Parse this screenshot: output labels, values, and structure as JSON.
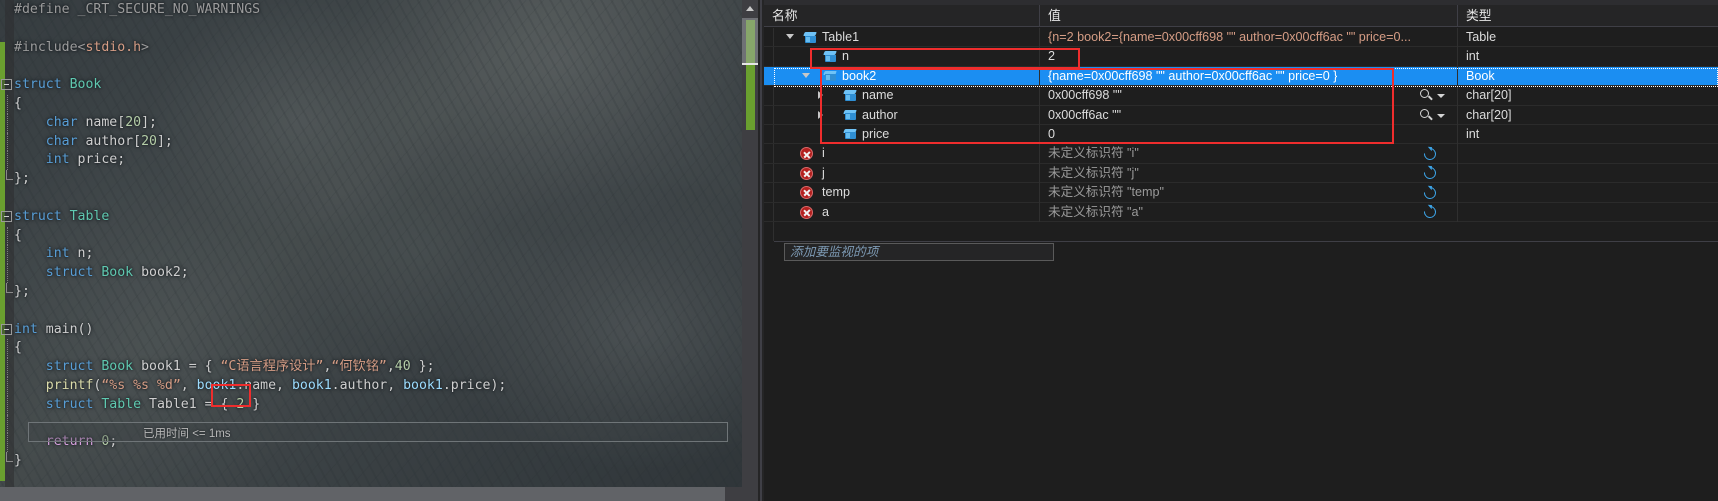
{
  "editor": {
    "code_lines": [
      {
        "indent": 0,
        "fold": false,
        "html": "<span class=\"pre\">#define _CRT_SECURE_NO_WARNINGS</span>"
      },
      {
        "indent": 0,
        "fold": false,
        "html": ""
      },
      {
        "indent": 0,
        "fold": false,
        "html": "<span class=\"pre\">#include&lt;</span><span class=\"hdr\">stdio.h</span><span class=\"pre\">&gt;</span>"
      },
      {
        "indent": 0,
        "fold": false,
        "html": ""
      },
      {
        "indent": 0,
        "fold": true,
        "html": "<span class=\"kw\">struct</span> <span class=\"typ\">Book</span>"
      },
      {
        "indent": 0,
        "fold": false,
        "html": "<span class=\"pun\">{</span>"
      },
      {
        "indent": 0,
        "fold": false,
        "html": "    <span class=\"kw\">char</span> <span class=\"pun\">name[</span><span class=\"num\">20</span><span class=\"pun\">];</span>"
      },
      {
        "indent": 0,
        "fold": false,
        "html": "    <span class=\"kw\">char</span> <span class=\"pun\">author[</span><span class=\"num\">20</span><span class=\"pun\">];</span>"
      },
      {
        "indent": 0,
        "fold": false,
        "html": "    <span class=\"kw\">int</span> <span class=\"pun\">price;</span>"
      },
      {
        "indent": 0,
        "fold": false,
        "html": "<span class=\"pun\">};</span>"
      },
      {
        "indent": 0,
        "fold": false,
        "html": ""
      },
      {
        "indent": 0,
        "fold": true,
        "html": "<span class=\"kw\">struct</span> <span class=\"typ\">Table</span>"
      },
      {
        "indent": 0,
        "fold": false,
        "html": "<span class=\"pun\">{</span>"
      },
      {
        "indent": 0,
        "fold": false,
        "html": "    <span class=\"kw\">int</span> <span class=\"pun\">n;</span>"
      },
      {
        "indent": 0,
        "fold": false,
        "html": "    <span class=\"kw\">struct</span> <span class=\"typ\">Book</span> <span class=\"pun\">book2;</span>"
      },
      {
        "indent": 0,
        "fold": false,
        "html": "<span class=\"pun\">};</span>"
      },
      {
        "indent": 0,
        "fold": false,
        "html": ""
      },
      {
        "indent": 0,
        "fold": true,
        "html": "<span class=\"kw\">int</span> <span class=\"pun\">main()</span>"
      },
      {
        "indent": 0,
        "fold": false,
        "html": "<span class=\"pun\">{</span>"
      },
      {
        "indent": 0,
        "fold": false,
        "html": "    <span class=\"kw\">struct</span> <span class=\"typ\">Book</span> <span class=\"pun\">book1 = { </span><span class=\"str\">“C语言程序设计”</span><span class=\"pun\">,</span><span class=\"str\">“何钦铭”</span><span class=\"pun\">,</span><span class=\"num\">40</span><span class=\"pun\"> };</span>"
      },
      {
        "indent": 0,
        "fold": false,
        "html": "    <span class=\"fn\">printf</span><span class=\"pun\">(</span><span class=\"str\">“%s %s %d”</span><span class=\"pun\">, </span><span class=\"var\">book1</span><span class=\"pun\">.name, </span><span class=\"var\">book1</span><span class=\"pun\">.author, </span><span class=\"var\">book1</span><span class=\"pun\">.price);</span>"
      },
      {
        "indent": 0,
        "fold": false,
        "html": "    <span class=\"kw\">struct</span> <span class=\"typ\">Table</span> <span class=\"pun\">Table1 = { </span><span class=\"num\">2</span><span class=\"pun\"> }</span>"
      },
      {
        "indent": 0,
        "fold": false,
        "html": ""
      },
      {
        "indent": 0,
        "fold": false,
        "html": "    <span class=\"ret\">return</span> <span class=\"num\">0</span><span class=\"pun\">;</span>"
      },
      {
        "indent": 0,
        "fold": false,
        "html": "<span class=\"pun\">}</span>"
      }
    ],
    "elapsed_label": "已用时间 <= 1ms",
    "highlight_snippet": "{ 2 }",
    "change_bar_color": "#6a9f2f"
  },
  "watch": {
    "columns": {
      "name": "名称",
      "value": "值",
      "type": "类型"
    },
    "add_watch_placeholder": "添加要监视的项",
    "selection_color": "#1b8ef2",
    "annotation_color": "#ef2d2d",
    "rows": [
      {
        "name": "Table1",
        "value": "{n=2 book2={name=0x00cff698 \"\" author=0x00cff6ac \"\" price=0...",
        "type": "Table",
        "icon": "cube-icon",
        "expander": "open",
        "depth": 0,
        "selected": false,
        "value_style": "aggregate",
        "action_icon": "none"
      },
      {
        "name": "n",
        "value": "2",
        "type": "int",
        "icon": "cube-icon",
        "expander": "none",
        "depth": 1,
        "selected": false,
        "value_style": "plain",
        "action_icon": "none"
      },
      {
        "name": "book2",
        "value": "{name=0x00cff698 \"\" author=0x00cff6ac \"\" price=0 }",
        "type": "Book",
        "icon": "cube-icon",
        "expander": "open",
        "depth": 1,
        "selected": true,
        "value_style": "plain",
        "action_icon": "none"
      },
      {
        "name": "name",
        "value": "0x00cff698 \"\"",
        "type": "char[20]",
        "icon": "cube-icon",
        "expander": "closed",
        "depth": 2,
        "selected": false,
        "value_style": "plain",
        "action_icon": "magnifier-icon"
      },
      {
        "name": "author",
        "value": "0x00cff6ac \"\"",
        "type": "char[20]",
        "icon": "cube-icon",
        "expander": "closed",
        "depth": 2,
        "selected": false,
        "value_style": "plain",
        "action_icon": "magnifier-icon"
      },
      {
        "name": "price",
        "value": "0",
        "type": "int",
        "icon": "cube-icon",
        "expander": "none",
        "depth": 2,
        "selected": false,
        "value_style": "plain",
        "action_icon": "none"
      },
      {
        "name": "i",
        "value": "未定义标识符 \"i\"",
        "type": "",
        "icon": "error-x-icon",
        "expander": "none",
        "depth": 0,
        "selected": false,
        "value_style": "err",
        "action_icon": "refresh-icon"
      },
      {
        "name": "j",
        "value": "未定义标识符 \"j\"",
        "type": "",
        "icon": "error-x-icon",
        "expander": "none",
        "depth": 0,
        "selected": false,
        "value_style": "err",
        "action_icon": "refresh-icon"
      },
      {
        "name": "temp",
        "value": "未定义标识符 \"temp\"",
        "type": "",
        "icon": "error-x-icon",
        "expander": "none",
        "depth": 0,
        "selected": false,
        "value_style": "err",
        "action_icon": "refresh-icon"
      },
      {
        "name": "a",
        "value": "未定义标识符 \"a\"",
        "type": "",
        "icon": "error-x-icon",
        "expander": "none",
        "depth": 0,
        "selected": false,
        "value_style": "err",
        "action_icon": "refresh-icon"
      }
    ]
  }
}
